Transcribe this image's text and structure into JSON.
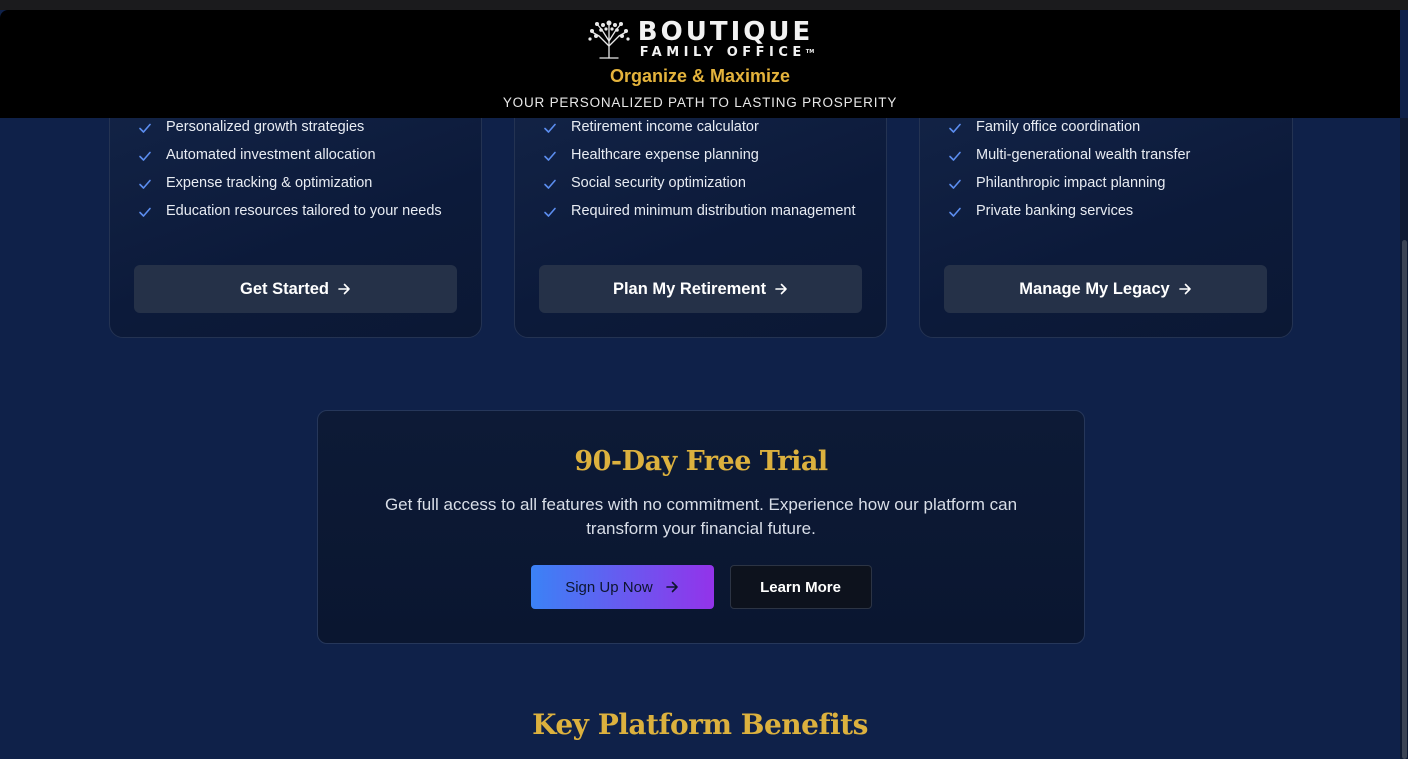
{
  "header": {
    "brand_main": "BOUTIQUE",
    "brand_sub": "FAMILY OFFICE",
    "brand_tm": "TM",
    "tagline": "Organize & Maximize",
    "subtitle": "YOUR PERSONALIZED PATH TO LASTING PROSPERITY"
  },
  "cards": [
    {
      "features": [
        "Personalized growth strategies",
        "Automated investment allocation",
        "Expense tracking & optimization",
        "Education resources tailored to your needs"
      ],
      "button_label": "Get Started"
    },
    {
      "features": [
        "Retirement income calculator",
        "Healthcare expense planning",
        "Social security optimization",
        "Required minimum distribution management"
      ],
      "button_label": "Plan My Retirement"
    },
    {
      "features": [
        "Family office coordination",
        "Multi-generational wealth transfer",
        "Philanthropic impact planning",
        "Private banking services"
      ],
      "button_label": "Manage My Legacy"
    }
  ],
  "trial": {
    "title": "90-Day Free Trial",
    "description": "Get full access to all features with no commitment. Experience how our platform can transform your financial future.",
    "signup_label": "Sign Up Now",
    "learn_label": "Learn More"
  },
  "benefits": {
    "title": "Key Platform Benefits"
  },
  "colors": {
    "gold": "#dcb13e",
    "page_bg": "#0f2149",
    "check": "#5b8def",
    "gradient_start": "#3b82f6",
    "gradient_end": "#9333ea"
  },
  "icons": {
    "check": "check-icon",
    "arrow": "arrow-right-icon",
    "logo": "tree-logo-icon"
  }
}
